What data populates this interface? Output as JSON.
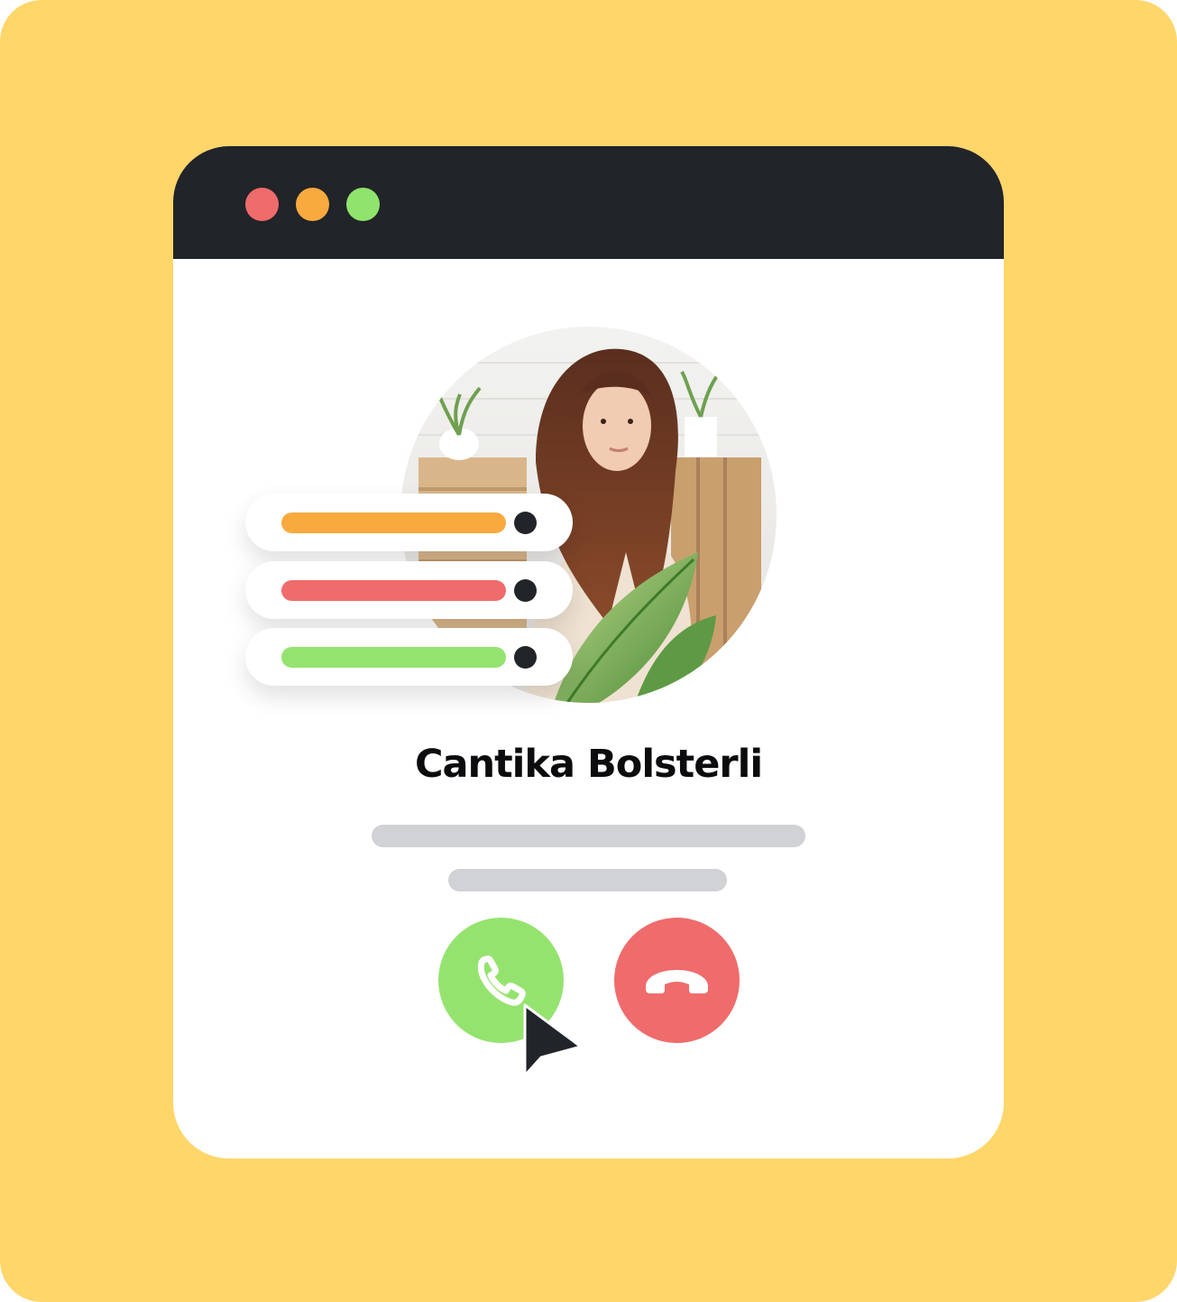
{
  "colors": {
    "background": "#FED66A",
    "window": "#FFFFFF",
    "titlebar": "#212428",
    "dot_red": "#F06B6B",
    "dot_orange": "#F9AA3F",
    "dot_green": "#8FE46D",
    "placeholder_line": "#D1D2D5",
    "accept": "#95E36F",
    "decline": "#F06B6B",
    "knob": "#212428",
    "cursor": "#212428"
  },
  "window_controls": [
    "close-dot",
    "minimize-dot",
    "maximize-dot"
  ],
  "avatar": {
    "icon": "profile-photo"
  },
  "status_bars": [
    {
      "color": "#F9AA3F",
      "fill": 1.0
    },
    {
      "color": "#F06B6B",
      "fill": 1.0
    },
    {
      "color": "#95E36F",
      "fill": 1.0
    }
  ],
  "contact": {
    "name": "Cantika Bolsterli"
  },
  "actions": {
    "accept_icon": "phone-icon",
    "decline_icon": "hang-up-icon",
    "pointer_icon": "cursor-arrow-icon"
  }
}
